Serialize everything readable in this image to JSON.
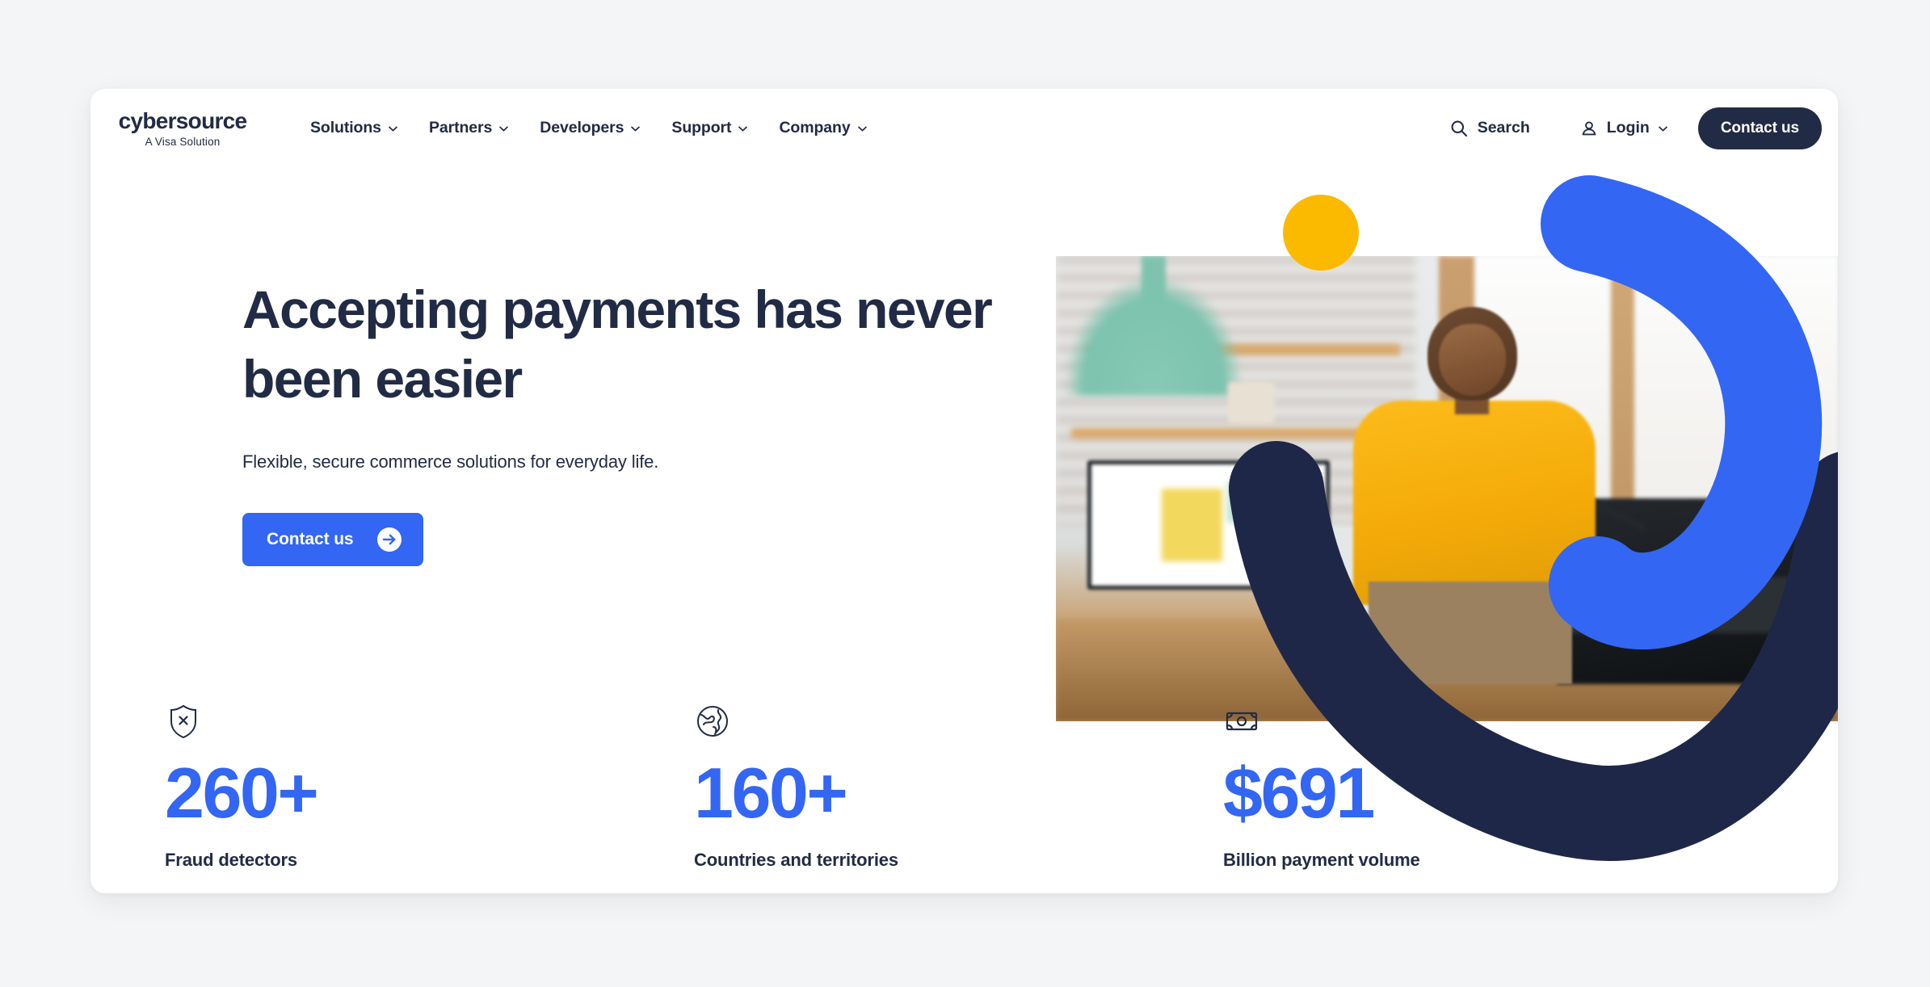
{
  "theme": {
    "page_bg": "#f4f5f6",
    "card_bg": "#ffffff",
    "navy": "#222b45",
    "blue": "#3366f2",
    "yellow": "#fbba00"
  },
  "header": {
    "logo": {
      "wordmark": "cybersource",
      "tagline": "A Visa Solution"
    },
    "nav_items": [
      {
        "label": "Solutions"
      },
      {
        "label": "Partners"
      },
      {
        "label": "Developers"
      },
      {
        "label": "Support"
      },
      {
        "label": "Company"
      }
    ],
    "search_label": "Search",
    "login_label": "Login",
    "contact_label": "Contact us"
  },
  "hero": {
    "title": "Accepting payments has never been easier",
    "subtitle": "Flexible, secure commerce solutions for everyday life.",
    "cta_label": "Contact us",
    "image_alt": "Woman in yellow sweater standing at a desk in a bright home office"
  },
  "stats": [
    {
      "icon": "shield-x-icon",
      "value": "260+",
      "label": "Fraud detectors"
    },
    {
      "icon": "globe-icon",
      "value": "160+",
      "label": "Countries and territories"
    },
    {
      "icon": "banknote-icon",
      "value": "$691",
      "label": "Billion payment volume"
    }
  ]
}
